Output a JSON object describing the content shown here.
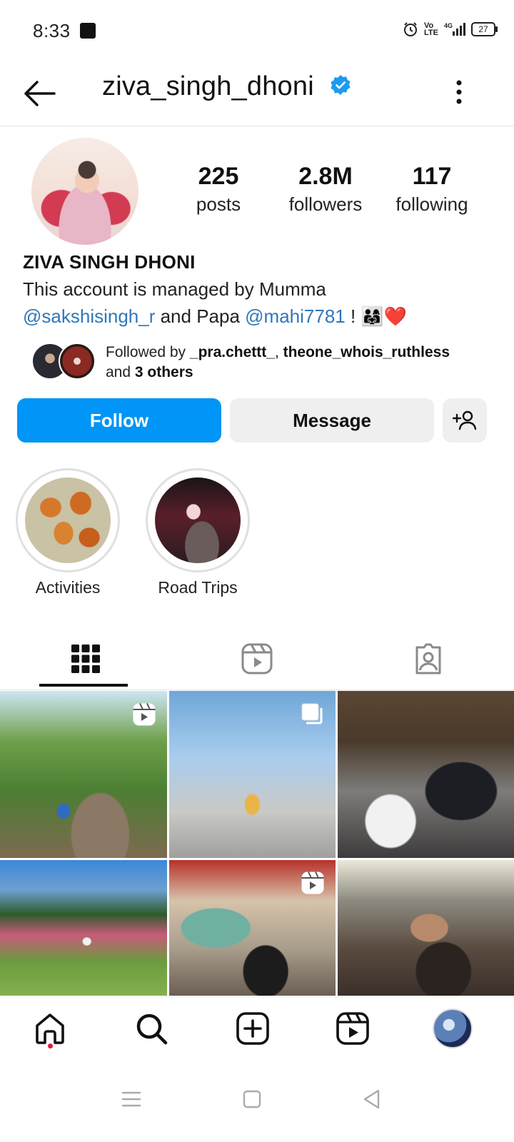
{
  "status_bar": {
    "time": "8:33",
    "battery": "27"
  },
  "header": {
    "username": "ziva_singh_dhoni",
    "more_icon": "more-vert-icon"
  },
  "profile": {
    "stats": [
      {
        "number": "225",
        "label": "posts"
      },
      {
        "number": "2.8M",
        "label": "followers"
      },
      {
        "number": "117",
        "label": "following"
      }
    ],
    "full_name": "ZIVA SINGH DHONI",
    "bio": {
      "line1": "This account is managed by Mumma",
      "mention1": "@sakshisingh_r",
      "middle": " and Papa ",
      "mention2": "@mahi7781",
      "suffix": " ! 👨‍👩‍👧❤️"
    },
    "followed_by": {
      "prefix": "Followed by ",
      "user1": "_pra.chettt_",
      "comma": ", ",
      "user2": "theone_whois_ruthless",
      "and": "and ",
      "others": "3 others"
    }
  },
  "buttons": {
    "follow": "Follow",
    "message": "Message"
  },
  "highlights": [
    {
      "label": "Activities"
    },
    {
      "label": "Road Trips"
    }
  ],
  "tabs": [
    "grid",
    "reels",
    "tagged"
  ],
  "colors": {
    "accent": "#0095f6",
    "link": "#2f77b8",
    "verified": "#1e9bf0",
    "notification_dot": "#e0193f"
  }
}
